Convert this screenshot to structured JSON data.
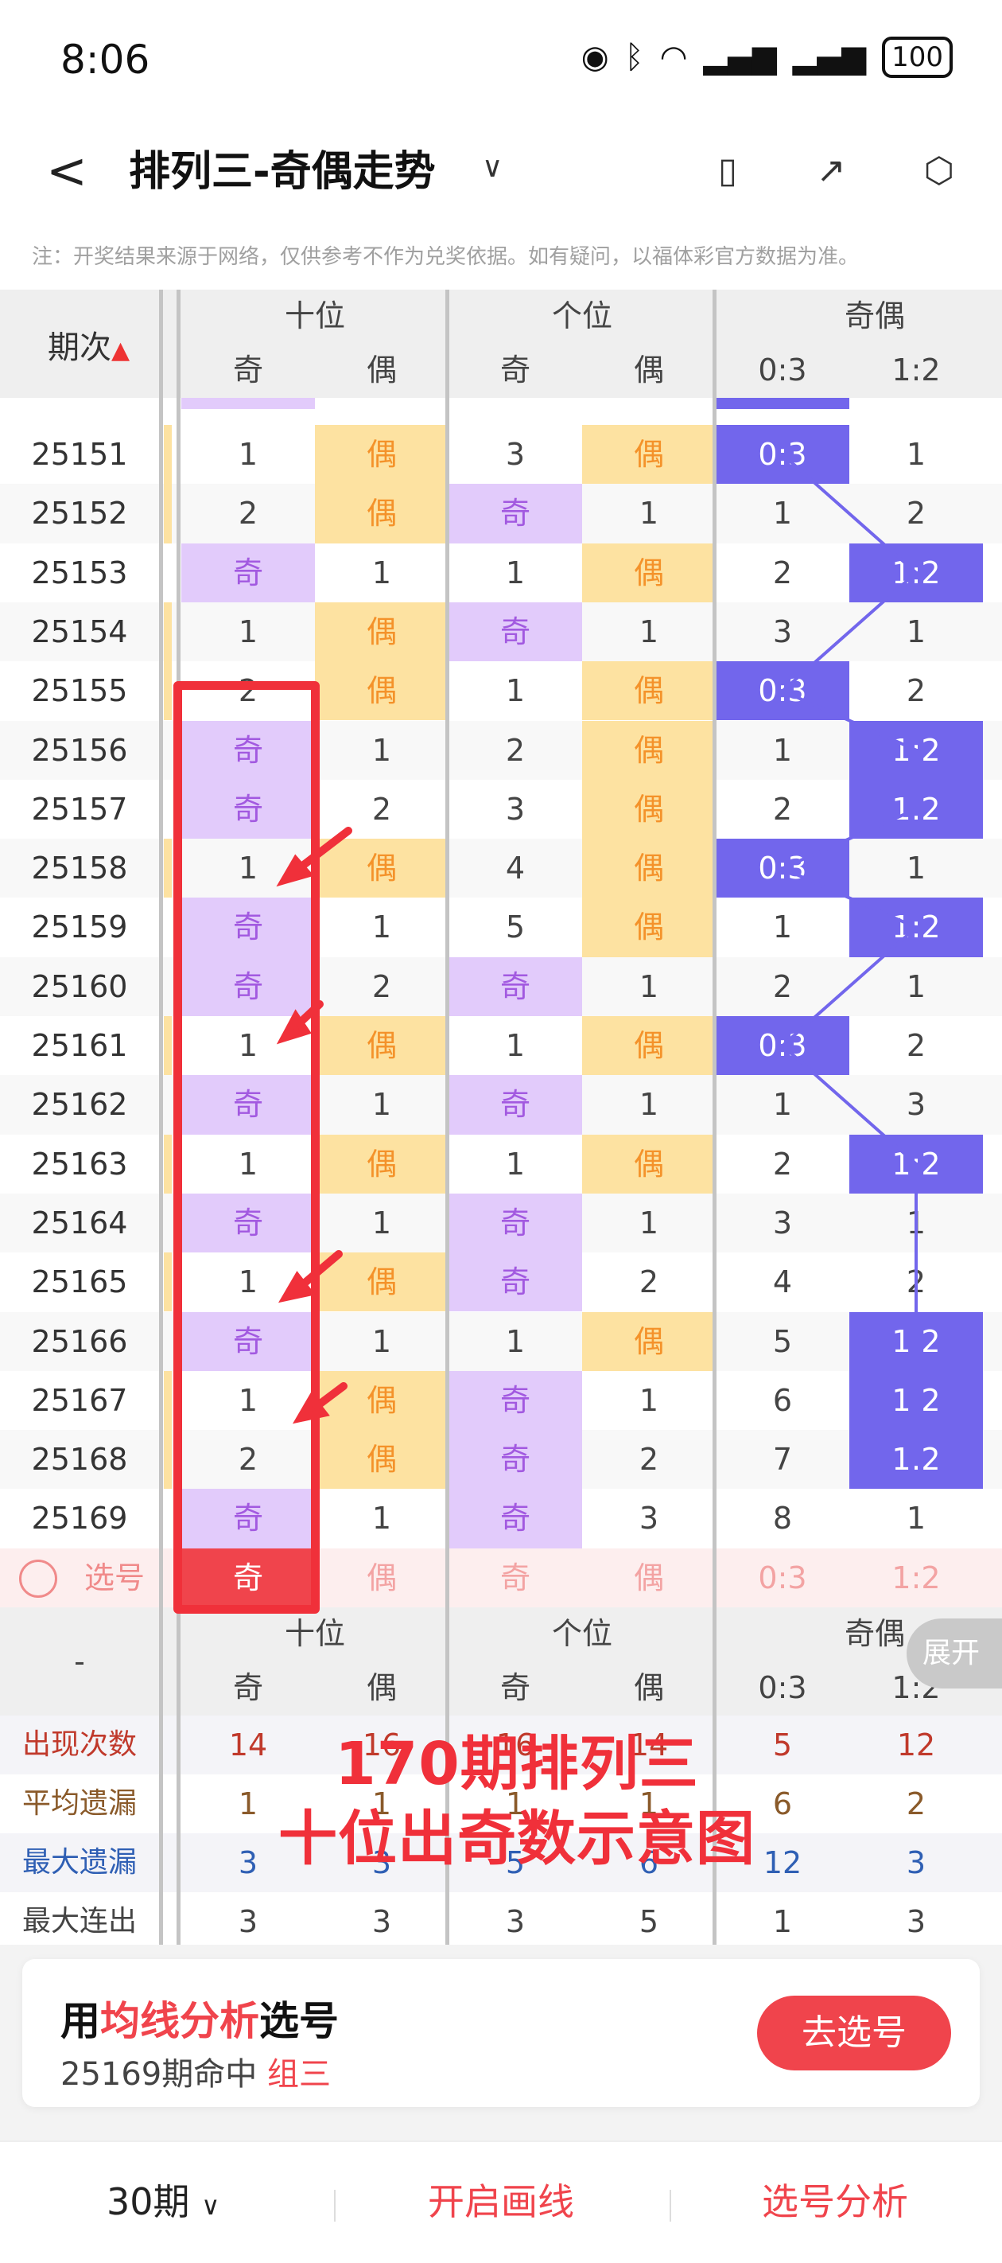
{
  "status": {
    "time": "8:06",
    "battery": "100"
  },
  "header": {
    "back": "<",
    "title": "排列三-奇偶走势"
  },
  "notice": "注：开奖结果来源于网络，仅供参考不作为兑奖依据。如有疑问，以福体彩官方数据为准。",
  "table": {
    "corner": "期次",
    "groups": [
      "十位",
      "个位",
      "奇偶"
    ],
    "sub": [
      "奇",
      "偶",
      "奇",
      "偶",
      "0:3",
      "1:2"
    ],
    "rows": [
      {
        "issue": "25151",
        "cells": [
          "1",
          "偶",
          "3",
          "偶",
          "0:3",
          "1"
        ]
      },
      {
        "issue": "25152",
        "cells": [
          "2",
          "偶",
          "奇",
          "1",
          "1",
          "2"
        ]
      },
      {
        "issue": "25153",
        "cells": [
          "奇",
          "1",
          "1",
          "偶",
          "2",
          "1:2"
        ]
      },
      {
        "issue": "25154",
        "cells": [
          "1",
          "偶",
          "奇",
          "1",
          "3",
          "1"
        ]
      },
      {
        "issue": "25155",
        "cells": [
          "2",
          "偶",
          "1",
          "偶",
          "0:3",
          "2"
        ]
      },
      {
        "issue": "25156",
        "cells": [
          "奇",
          "1",
          "2",
          "偶",
          "1",
          "1:2"
        ]
      },
      {
        "issue": "25157",
        "cells": [
          "奇",
          "2",
          "3",
          "偶",
          "2",
          "1:2"
        ]
      },
      {
        "issue": "25158",
        "cells": [
          "1",
          "偶",
          "4",
          "偶",
          "0:3",
          "1"
        ]
      },
      {
        "issue": "25159",
        "cells": [
          "奇",
          "1",
          "5",
          "偶",
          "1",
          "1:2"
        ]
      },
      {
        "issue": "25160",
        "cells": [
          "奇",
          "2",
          "奇",
          "1",
          "2",
          "1"
        ]
      },
      {
        "issue": "25161",
        "cells": [
          "1",
          "偶",
          "1",
          "偶",
          "0:3",
          "2"
        ]
      },
      {
        "issue": "25162",
        "cells": [
          "奇",
          "1",
          "奇",
          "1",
          "1",
          "3"
        ]
      },
      {
        "issue": "25163",
        "cells": [
          "1",
          "偶",
          "1",
          "偶",
          "2",
          "1:2"
        ]
      },
      {
        "issue": "25164",
        "cells": [
          "奇",
          "1",
          "奇",
          "1",
          "3",
          "1"
        ]
      },
      {
        "issue": "25165",
        "cells": [
          "1",
          "偶",
          "奇",
          "2",
          "4",
          "2"
        ]
      },
      {
        "issue": "25166",
        "cells": [
          "奇",
          "1",
          "1",
          "偶",
          "5",
          "1:2"
        ]
      },
      {
        "issue": "25167",
        "cells": [
          "1",
          "偶",
          "奇",
          "1",
          "6",
          "1:2"
        ]
      },
      {
        "issue": "25168",
        "cells": [
          "2",
          "偶",
          "奇",
          "2",
          "7",
          "1:2"
        ]
      },
      {
        "issue": "25169",
        "cells": [
          "奇",
          "1",
          "奇",
          "3",
          "8",
          "1"
        ]
      }
    ],
    "pick": {
      "label": "选号",
      "cells": [
        "奇",
        "偶",
        "奇",
        "偶",
        "0:3",
        "1:2"
      ]
    },
    "expand": "展开",
    "stats": [
      {
        "label": "出现次数",
        "cells": [
          "14",
          "16",
          "16",
          "14",
          "5",
          "12"
        ]
      },
      {
        "label": "平均遗漏",
        "cells": [
          "1",
          "1",
          "1",
          "1",
          "6",
          "2"
        ]
      },
      {
        "label": "最大遗漏",
        "cells": [
          "3",
          "3",
          "5",
          "6",
          "12",
          "3"
        ]
      },
      {
        "label": "最大连出",
        "cells": [
          "3",
          "3",
          "3",
          "5",
          "1",
          "3"
        ]
      }
    ],
    "dash": "-"
  },
  "overlay": {
    "line1": "170期排列三",
    "line2": "十位出奇数示意图"
  },
  "card": {
    "pre": "用",
    "hl": "均线分析",
    "post": "选号",
    "sub_pre": "25169期命中 ",
    "sub_hl": "组三",
    "btn": "去选号"
  },
  "nav": {
    "period": "30期",
    "draw": "开启画线",
    "analysis": "选号分析"
  },
  "colors": {
    "odd": "#e2cbfb",
    "even": "#fde2a1",
    "blue": "#7266ec",
    "red": "#f0444c",
    "oddText": "#a259e0",
    "evenText": "#f4922a"
  }
}
